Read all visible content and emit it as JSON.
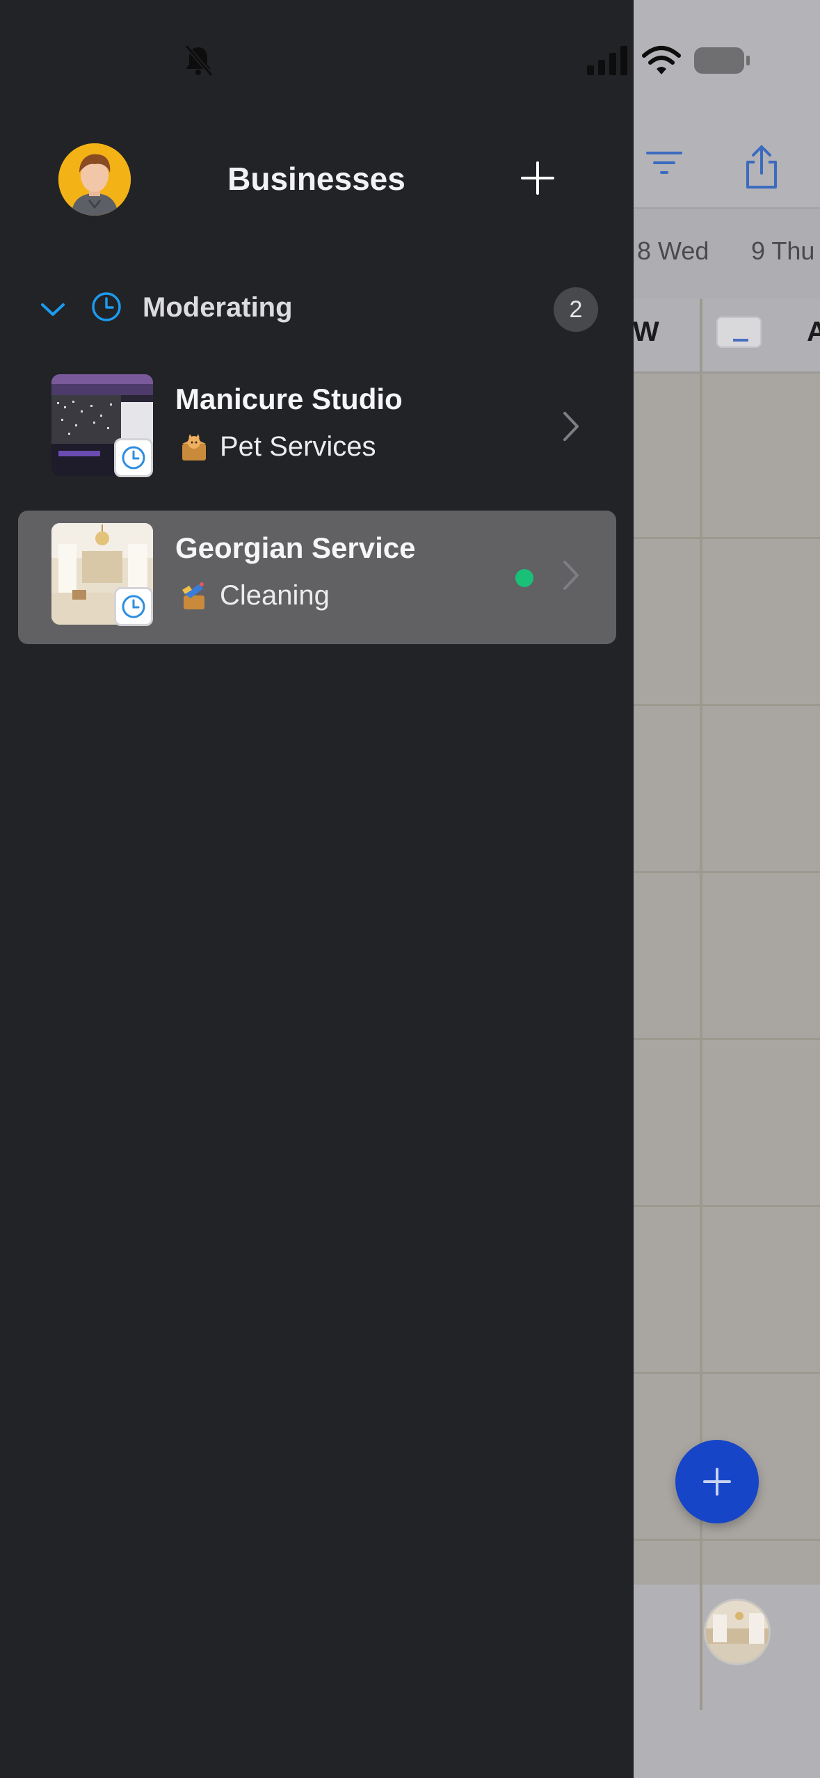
{
  "drawer": {
    "title": "Businesses",
    "group": {
      "label": "Moderating",
      "count": "2"
    },
    "businesses": [
      {
        "name": "Manicure Studio",
        "category": "Pet Services",
        "online": false,
        "selected": false
      },
      {
        "name": "Georgian Service",
        "category": "Cleaning",
        "online": true,
        "selected": true
      }
    ]
  },
  "background_app": {
    "days": [
      "8 Wed",
      "9 Thu"
    ],
    "columns": [
      "W",
      "A"
    ]
  },
  "colors": {
    "drawer_bg": "#222326",
    "accent_blue": "#1d9bf0",
    "fab_blue": "#1645c7",
    "online_green": "#1abf78",
    "selected_row": "#616164"
  },
  "icons": {
    "status": [
      "bell-slash-icon",
      "cellular-signal-icon",
      "wifi-icon",
      "battery-icon"
    ],
    "header": [
      "avatar",
      "plus-icon"
    ],
    "group": [
      "chevron-down-icon",
      "clock-icon"
    ],
    "items": [
      "clock-icon",
      "chevron-right-icon"
    ],
    "background": [
      "filter-icon",
      "share-icon",
      "plus-icon"
    ]
  }
}
